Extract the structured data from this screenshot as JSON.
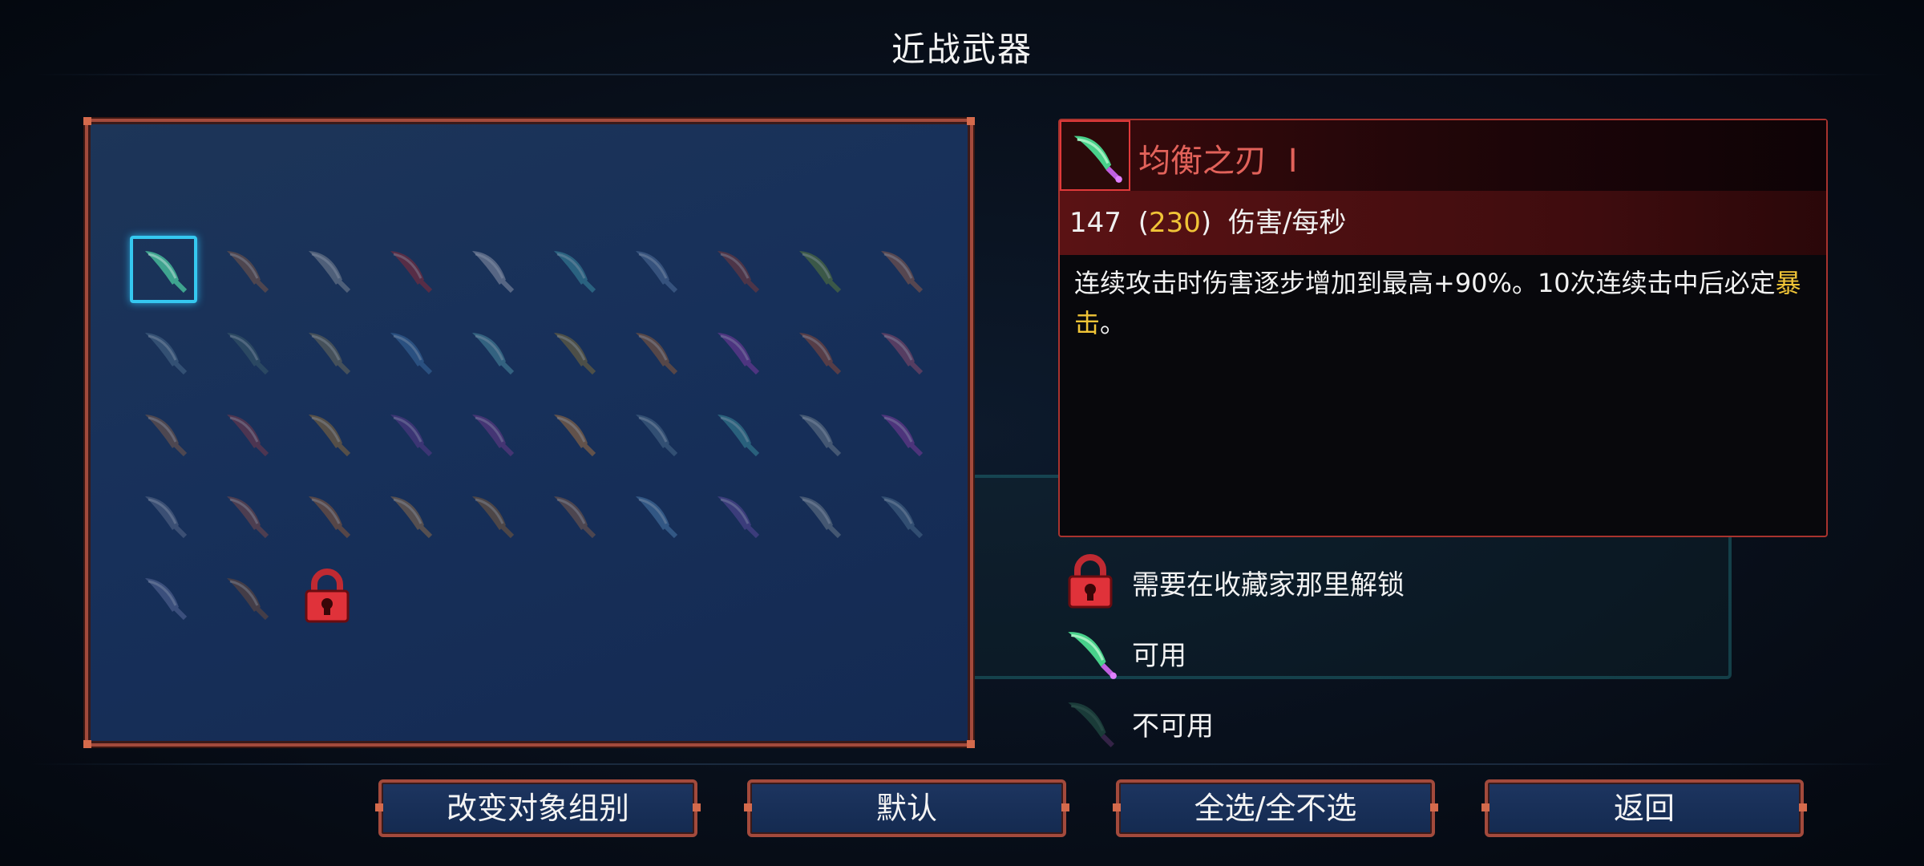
{
  "title": "近战武器",
  "detail": {
    "name": "均衡之刃",
    "level_mark": "I",
    "stats": {
      "base": "147",
      "open": "(",
      "bonus": "230",
      "close": ")",
      "unit": "伤害/每秒"
    },
    "description_main": "连续攻击时伤害逐步增加到最高+90%。10次连续击中后必定",
    "description_highlight": "暴击",
    "description_end": "。"
  },
  "legend": [
    {
      "icon": "lock-icon",
      "label": "需要在收藏家那里解锁"
    },
    {
      "icon": "blade-available-icon",
      "label": "可用"
    },
    {
      "icon": "blade-unavailable-icon",
      "label": "不可用"
    }
  ],
  "buttons": {
    "change_group": "改变对象组别",
    "default": "默认",
    "select_all": "全选/全不选",
    "back": "返回"
  },
  "weapons": [
    {
      "name": "balanced-blade-icon",
      "selected": true,
      "color": "#3fa48f"
    },
    {
      "name": "rusty-sword-icon",
      "color": "#7a5648"
    },
    {
      "name": "broadsword-icon",
      "color": "#7b8494"
    },
    {
      "name": "blood-sword-icon",
      "color": "#8a2a38"
    },
    {
      "name": "twin-daggers-icon",
      "color": "#8a93a8"
    },
    {
      "name": "assassin-dagger-icon",
      "color": "#3a8aa0"
    },
    {
      "name": "shovel-icon",
      "color": "#4f6e9a"
    },
    {
      "name": "spite-sword-icon",
      "color": "#7a3a3a"
    },
    {
      "name": "spear-icon",
      "color": "#5a7a3a"
    },
    {
      "name": "flashing-fans-icon",
      "color": "#8a5a4a"
    },
    {
      "name": "sickles-icon",
      "color": "#4a6a8a"
    },
    {
      "name": "axe-icon",
      "color": "#3a5a6a"
    },
    {
      "name": "cleaver-icon",
      "color": "#6a6a5a"
    },
    {
      "name": "frost-blade-icon",
      "color": "#3a6aa0"
    },
    {
      "name": "rapier-icon",
      "color": "#4a8aa0"
    },
    {
      "name": "nutcracker-icon",
      "color": "#7a6a3a"
    },
    {
      "name": "whip-icon",
      "color": "#8a5a3a"
    },
    {
      "name": "umbrella-icon",
      "color": "#7a3aa0"
    },
    {
      "name": "hammer-icon",
      "color": "#8a4a3a"
    },
    {
      "name": "boot-icon",
      "color": "#8a4a6a"
    },
    {
      "name": "kick-boot-icon",
      "color": "#7a5a4a"
    },
    {
      "name": "hat-icon",
      "color": "#7a3a4a"
    },
    {
      "name": "torch-icon",
      "color": "#8a6a3a"
    },
    {
      "name": "tentacle-icon",
      "color": "#5a3a8a"
    },
    {
      "name": "claw-icon",
      "color": "#6a3a8a"
    },
    {
      "name": "fire-blade-icon",
      "color": "#a07040"
    },
    {
      "name": "katana-icon",
      "color": "#4a6a8a"
    },
    {
      "name": "trident-icon",
      "color": "#3a8a9a"
    },
    {
      "name": "scythe-icon",
      "color": "#6a7a8a"
    },
    {
      "name": "purple-hook-icon",
      "color": "#7a3a9a"
    },
    {
      "name": "magnifier-icon",
      "color": "#5a6a8a"
    },
    {
      "name": "war-fan-icon",
      "color": "#7a4a4a"
    },
    {
      "name": "curved-hook-icon",
      "color": "#8a5a3a"
    },
    {
      "name": "lute-icon",
      "color": "#8a6a4a"
    },
    {
      "name": "cane-icon",
      "color": "#7a5a3a"
    },
    {
      "name": "feather-blade-icon",
      "color": "#7a5a4a"
    },
    {
      "name": "baton-icon",
      "color": "#4a7aaa"
    },
    {
      "name": "lantern-icon",
      "color": "#5a4a9a"
    },
    {
      "name": "machete-icon",
      "color": "#6a7a8a"
    },
    {
      "name": "tombstone-icon",
      "color": "#4a6a8a"
    },
    {
      "name": "war-axe-icon",
      "color": "#5a6a9a"
    },
    {
      "name": "spiked-club-icon",
      "color": "#6a4a3a"
    },
    {
      "name": "lock-icon",
      "color": "#e0323a"
    }
  ]
}
